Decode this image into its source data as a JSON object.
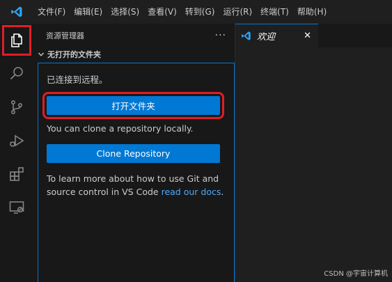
{
  "menu": {
    "items": [
      "文件(F)",
      "编辑(E)",
      "选择(S)",
      "查看(V)",
      "转到(G)",
      "运行(R)",
      "终端(T)",
      "帮助(H)"
    ]
  },
  "activity_bar": {
    "items": [
      "files-icon",
      "search-icon",
      "source-control-icon",
      "run-debug-icon",
      "extensions-icon",
      "remote-explorer-icon"
    ]
  },
  "sidebar": {
    "title": "资源管理器",
    "more": "···",
    "section_title": "无打开的文件夹",
    "connected_text": "已连接到远程。",
    "open_folder_label": "打开文件夹",
    "clone_text": "You can clone a repository locally.",
    "clone_button_label": "Clone Repository",
    "learn_line1": "To learn more about how to use Git and",
    "learn_line2_prefix": "source control in VS Code ",
    "learn_link": "read our docs",
    "learn_suffix": "."
  },
  "editor": {
    "tab_label": "欢迎",
    "tab_close": "✕"
  },
  "watermark": "CSDN @宇宙计算机",
  "colors": {
    "accent": "#0078d4",
    "highlight": "#e11d26",
    "link": "#4daafc"
  }
}
